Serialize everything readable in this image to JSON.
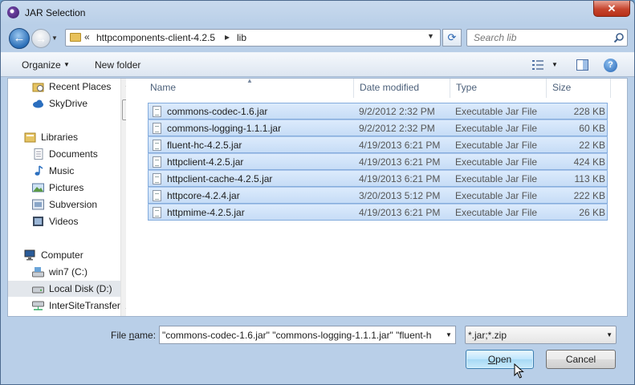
{
  "window": {
    "title": "JAR Selection",
    "close_label": "✕"
  },
  "address": {
    "overflow": "«",
    "segments": [
      "httpcomponents-client-4.2.5",
      "lib"
    ],
    "separator": "▸"
  },
  "search": {
    "placeholder": "Search lib"
  },
  "toolbar": {
    "organize_label": "Organize",
    "new_folder_label": "New folder",
    "help_label": "?"
  },
  "navpane": {
    "items": [
      {
        "label": "Recent Places",
        "icon": "recent-places-icon"
      },
      {
        "label": "SkyDrive",
        "icon": "skydrive-icon"
      },
      {
        "label": "Libraries",
        "icon": "libraries-icon"
      },
      {
        "label": "Documents",
        "icon": "documents-icon"
      },
      {
        "label": "Music",
        "icon": "music-icon"
      },
      {
        "label": "Pictures",
        "icon": "pictures-icon"
      },
      {
        "label": "Subversion",
        "icon": "subversion-icon"
      },
      {
        "label": "Videos",
        "icon": "videos-icon"
      },
      {
        "label": "Computer",
        "icon": "computer-icon"
      },
      {
        "label": "win7 (C:)",
        "icon": "drive-icon"
      },
      {
        "label": "Local Disk (D:)",
        "icon": "drive-icon",
        "selected": true
      },
      {
        "label": "InterSiteTransfer",
        "icon": "network-drive-icon"
      }
    ]
  },
  "filelist": {
    "columns": {
      "name": "Name",
      "date": "Date modified",
      "type": "Type",
      "size": "Size"
    },
    "rows": [
      {
        "name": "commons-codec-1.6.jar",
        "date": "9/2/2012 2:32 PM",
        "type": "Executable Jar File",
        "size": "228 KB"
      },
      {
        "name": "commons-logging-1.1.1.jar",
        "date": "9/2/2012 2:32 PM",
        "type": "Executable Jar File",
        "size": "60 KB"
      },
      {
        "name": "fluent-hc-4.2.5.jar",
        "date": "4/19/2013 6:21 PM",
        "type": "Executable Jar File",
        "size": "22 KB"
      },
      {
        "name": "httpclient-4.2.5.jar",
        "date": "4/19/2013 6:21 PM",
        "type": "Executable Jar File",
        "size": "424 KB"
      },
      {
        "name": "httpclient-cache-4.2.5.jar",
        "date": "4/19/2013 6:21 PM",
        "type": "Executable Jar File",
        "size": "113 KB"
      },
      {
        "name": "httpcore-4.2.4.jar",
        "date": "3/20/2013 5:12 PM",
        "type": "Executable Jar File",
        "size": "222 KB"
      },
      {
        "name": "httpmime-4.2.5.jar",
        "date": "4/19/2013 6:21 PM",
        "type": "Executable Jar File",
        "size": "26 KB"
      }
    ]
  },
  "footer": {
    "file_name_label_pre": "File ",
    "file_name_label_underlined": "n",
    "file_name_label_post": "ame:",
    "file_name_value": "\"commons-codec-1.6.jar\" \"commons-logging-1.1.1.jar\" \"fluent-h",
    "filter_value": "*.jar;*.zip",
    "open_label_underlined": "O",
    "open_label_rest": "pen",
    "cancel_label": "Cancel"
  }
}
